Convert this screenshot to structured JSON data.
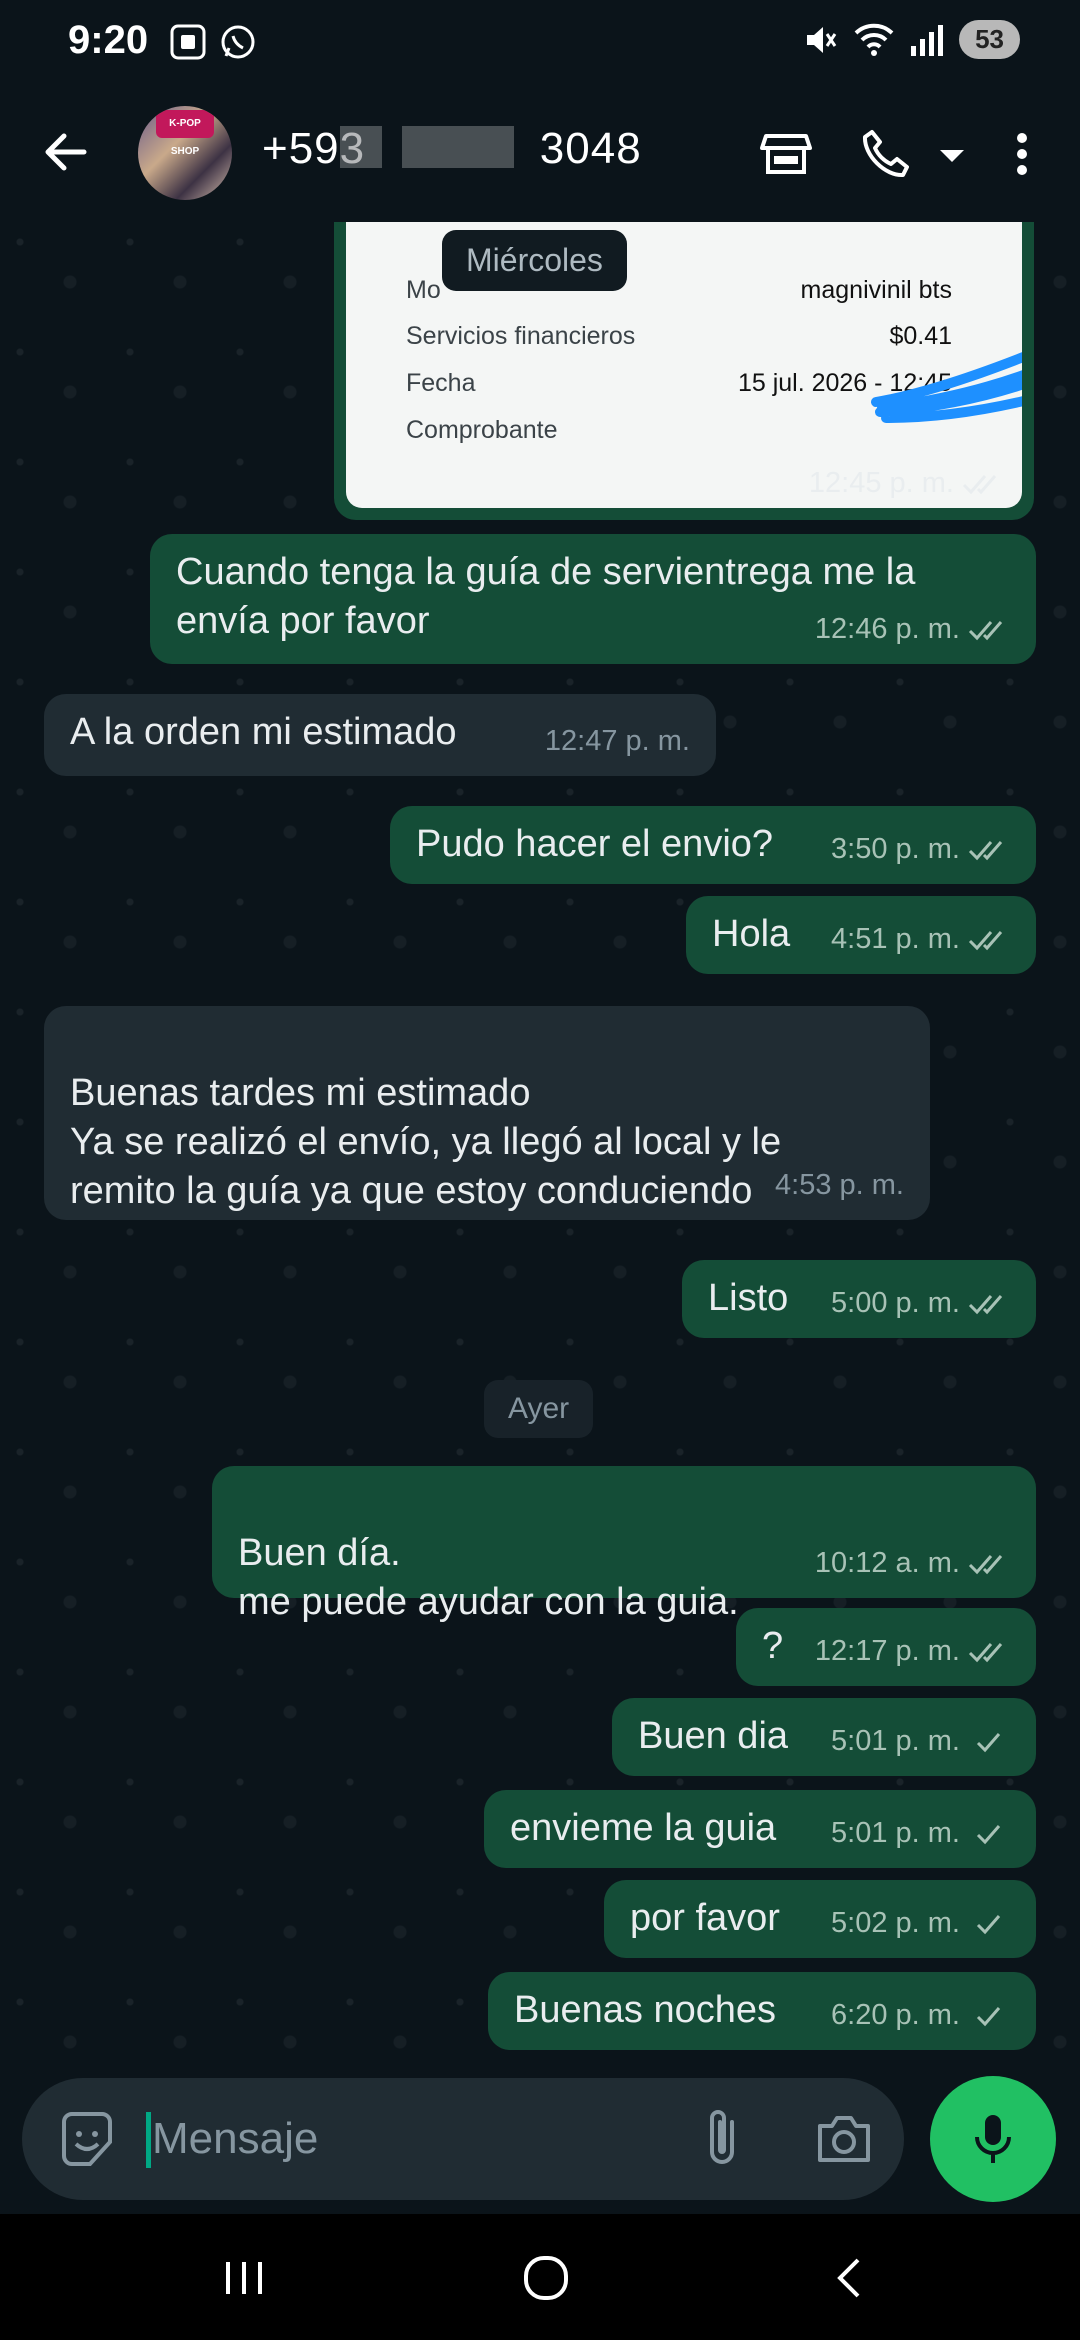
{
  "status_bar": {
    "time": "9:20",
    "battery": "53"
  },
  "header": {
    "contact_number": "+593       3048",
    "avatar_badge": "K-POP SHOP"
  },
  "receipt": {
    "rows": [
      {
        "label": "Mo",
        "value": "magnivinil bts"
      },
      {
        "label": "Servicios financieros",
        "value": "$0.41"
      },
      {
        "label": "Fecha",
        "value": "15 jul. 2026 - 12:45"
      },
      {
        "label": "Comprobante",
        "value": ""
      }
    ],
    "time": "12:45 p. m."
  },
  "day_labels": {
    "wednesday": "Miércoles",
    "yesterday": "Ayer"
  },
  "messages": [
    {
      "text": "Cuando tenga la guía de servientrega me la envía por favor",
      "time": "12:46 p. m."
    },
    {
      "text": "A la orden mi estimado",
      "time": "12:47 p. m."
    },
    {
      "text": "Pudo hacer el envio?",
      "time": "3:50 p. m."
    },
    {
      "text": "Hola",
      "time": "4:51 p. m."
    },
    {
      "text": "Buenas tardes mi estimado\nYa se realizó el envío, ya llegó al local y le remito la guía ya que estoy conduciendo",
      "time": "4:53 p. m."
    },
    {
      "text": "Listo",
      "time": "5:00 p. m."
    },
    {
      "text": "Buen día.\nme puede ayudar con la guia.",
      "time": "10:12 a. m."
    },
    {
      "text": "?",
      "time": "12:17 p. m."
    },
    {
      "text": "Buen dia",
      "time": "5:01 p. m."
    },
    {
      "text": "envieme la guia",
      "time": "5:01 p. m."
    },
    {
      "text": "por favor",
      "time": "5:02 p. m."
    },
    {
      "text": "Buenas noches",
      "time": "6:20 p. m."
    }
  ],
  "input": {
    "placeholder": "Mensaje"
  },
  "colors": {
    "outgoing": "#144d37",
    "incoming": "#202c33",
    "accent": "#21c063",
    "background": "#0b141a"
  }
}
